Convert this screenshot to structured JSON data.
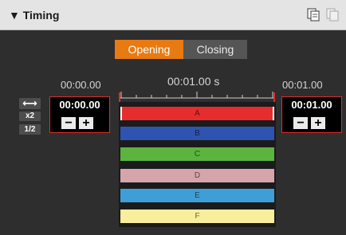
{
  "panel": {
    "title": "▼ Timing",
    "icons": [
      "copy-icon",
      "paste-icon"
    ]
  },
  "tabs": [
    {
      "label": "Opening",
      "active": true
    },
    {
      "label": "Closing",
      "active": false
    }
  ],
  "timeline": {
    "start_label": "00:00.00",
    "center_label": "00:01.00 s",
    "end_label": "00:01.00"
  },
  "controls": {
    "swap": "⟷",
    "double": "x2",
    "half": "1/2"
  },
  "start_box": {
    "value": "00:00.00",
    "minus": "−",
    "plus": "+"
  },
  "end_box": {
    "value": "00:01.00",
    "minus": "−",
    "plus": "+"
  },
  "tracks": [
    {
      "label": "A",
      "color": "#e52d2d",
      "selected": true
    },
    {
      "label": "B",
      "color": "#2f53b0"
    },
    {
      "label": "C",
      "color": "#5cb43e"
    },
    {
      "label": "D",
      "color": "#d6a5ab"
    },
    {
      "label": "E",
      "color": "#3e9fd8"
    },
    {
      "label": "F",
      "color": "#f9ee9b"
    }
  ],
  "colors": {
    "accent": "#e87a12",
    "highlight": "#e22b2b"
  }
}
